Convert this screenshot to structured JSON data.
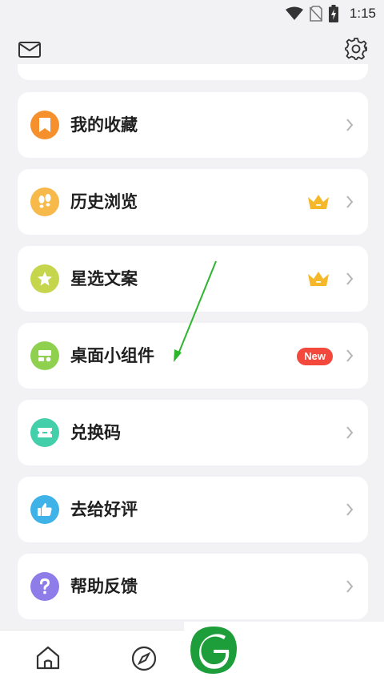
{
  "status_bar": {
    "time": "1:15",
    "icons": [
      "wifi-icon",
      "no-sim-icon",
      "battery-charging-icon"
    ]
  },
  "top_bar": {
    "icons": [
      "mail-icon",
      "gear-icon"
    ]
  },
  "menu": {
    "items": [
      {
        "label": "我的收藏",
        "icon": "bookmark-icon",
        "icon_color": "#f5902c",
        "badge": null
      },
      {
        "label": "历史浏览",
        "icon": "footprints-icon",
        "icon_color": "#f6b94a",
        "badge": "crown"
      },
      {
        "label": "星选文案",
        "icon": "star-icon",
        "icon_color": "#c6d64c",
        "badge": "crown"
      },
      {
        "label": "桌面小组件",
        "icon": "widget-icon",
        "icon_color": "#8fd14f",
        "badge": "New"
      },
      {
        "label": "兑换码",
        "icon": "ticket-icon",
        "icon_color": "#43cfa9",
        "badge": null
      },
      {
        "label": "去给好评",
        "icon": "thumbs-up-icon",
        "icon_color": "#3fb3e8",
        "badge": null
      },
      {
        "label": "帮助反馈",
        "icon": "question-icon",
        "icon_color": "#8e7de8",
        "badge": null
      }
    ]
  },
  "bottom_nav": {
    "icons": [
      "home-icon",
      "compass-icon"
    ]
  },
  "colors": {
    "background": "#f2f2f4",
    "card": "#ffffff",
    "crown": "#f5b82b",
    "new_badge": "#f2493c",
    "annotation_arrow": "#2db52d",
    "watermark_green": "#1e9e3a"
  }
}
